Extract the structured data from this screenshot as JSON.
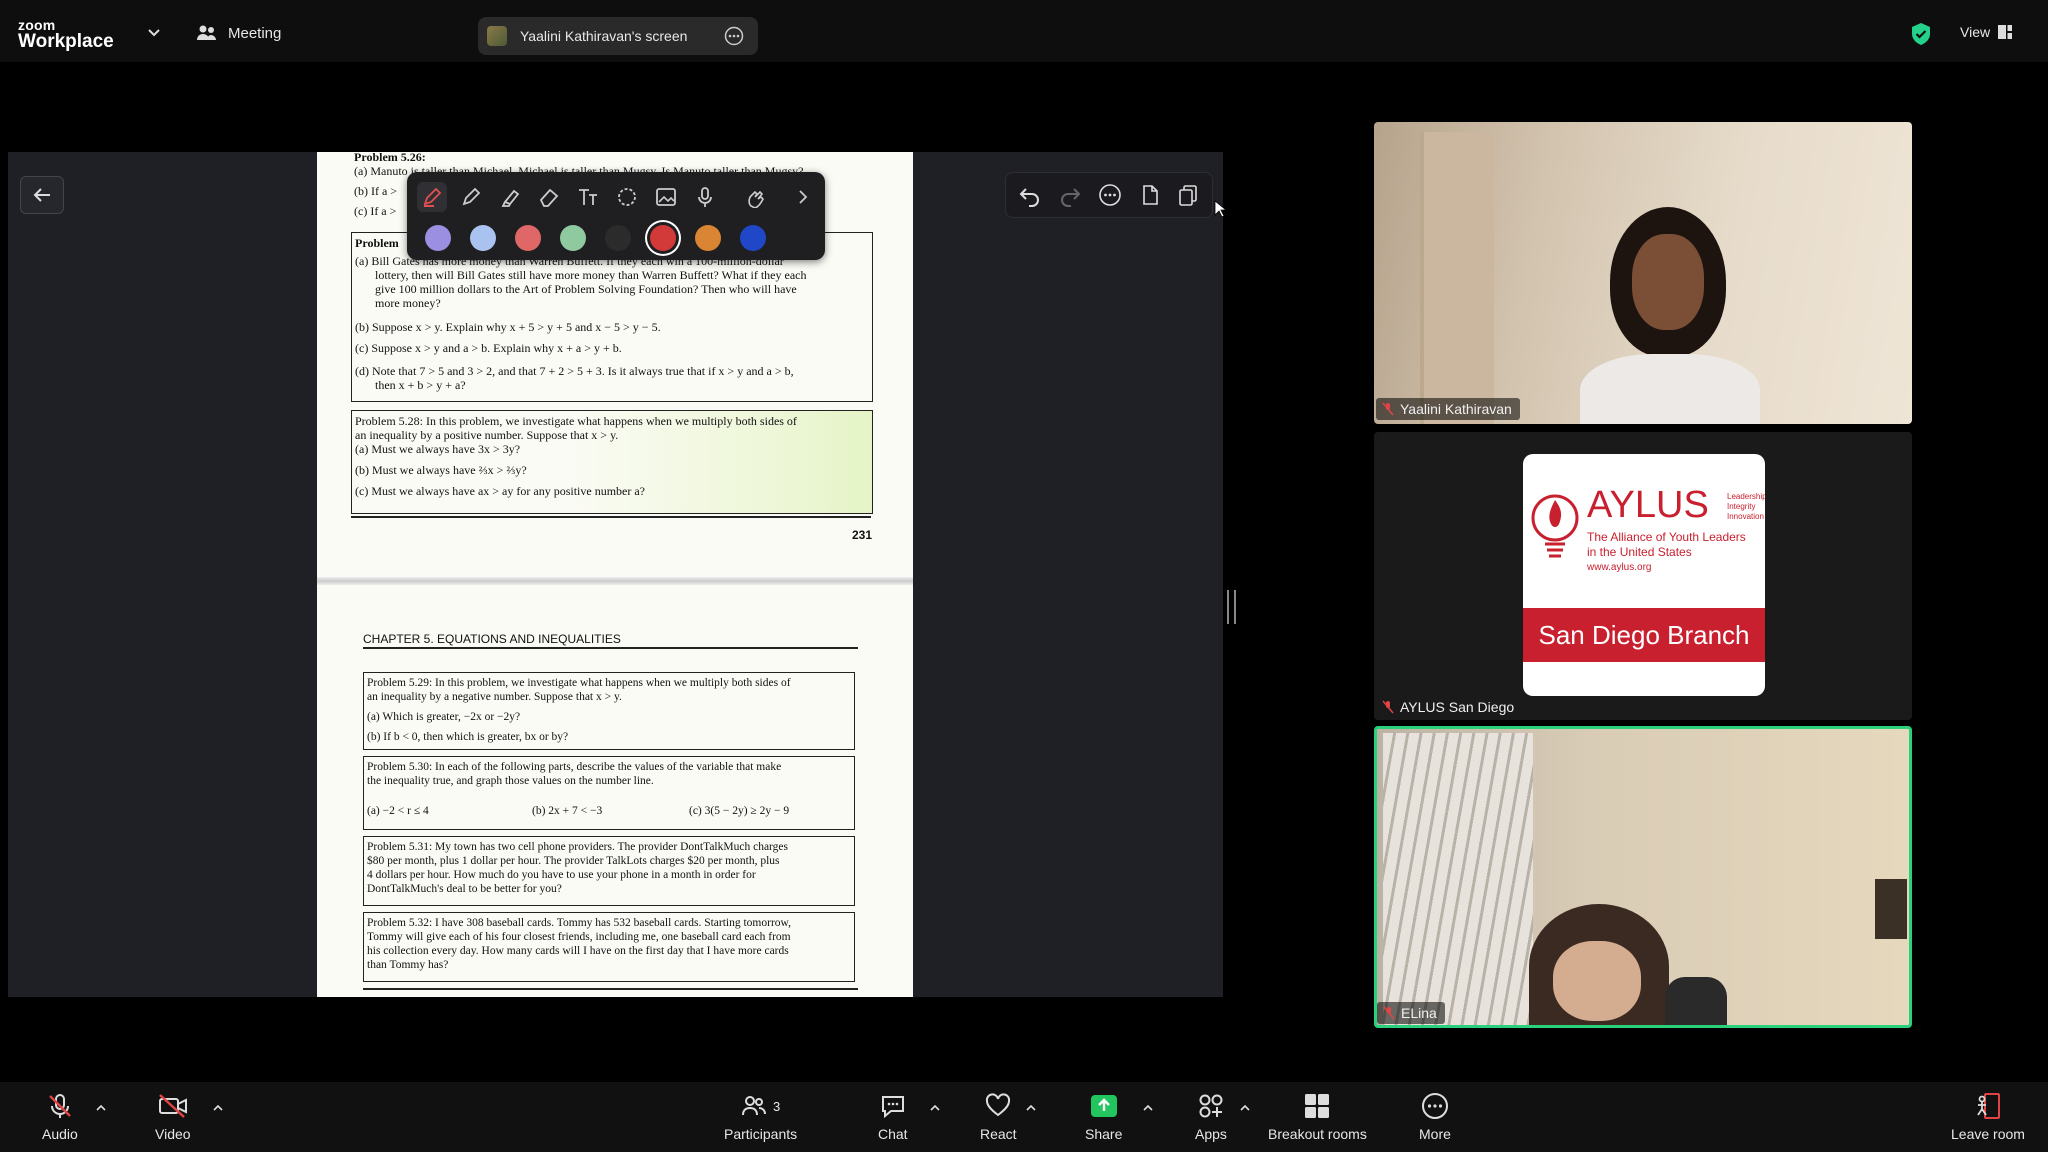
{
  "topbar": {
    "logo_small": "zoom",
    "logo_big": "Workplace",
    "meeting_label": "Meeting",
    "sharing_label": "Yaalini Kathiravan's screen",
    "view_label": "View"
  },
  "colors": {
    "accent_green": "#23d18b",
    "active_speaker_border": "#2ad07a",
    "brand_red": "#c8202f",
    "share_green": "#22c55e"
  },
  "document": {
    "top_problem_title": "Problem 5.26:",
    "top_lines": [
      "(a) Manuto is taller than Michael. Michael is taller than Mugsy. Is Manuto taller than Mugsy?",
      "(b) If a > ",
      "(c) If a > "
    ],
    "p527_label": "Problem",
    "p527_lines": [
      "(a) Bill Gates has more money than Warren Buffett. If they each win a 100-million-dollar",
      "lottery, then will Bill Gates still have more money than Warren Buffett? What if they each",
      "give 100 million dollars to the Art of Problem Solving Foundation? Then who will have",
      "more money?",
      "(b) Suppose x > y. Explain why x + 5 > y + 5 and x − 5 > y − 5.",
      "(c) Suppose x > y and a > b. Explain why x + a > y + b.",
      "(d) Note that 7 > 5 and 3 > 2, and that 7 + 2 > 5 + 3. Is it always true that if x > y and a > b,",
      "then x + b > y + a?"
    ],
    "p528_lines": [
      "Problem 5.28: In this problem, we investigate what happens when we multiply both sides of",
      "an inequality by a positive number. Suppose that x > y.",
      "(a) Must we always have 3x > 3y?",
      "(b) Must we always have ⅔x > ⅔y?",
      "(c) Must we always have ax > ay for any positive number a?"
    ],
    "page_number": "231",
    "chapter_header": "CHAPTER 5.  EQUATIONS AND INEQUALITIES",
    "p529_lines": [
      "Problem 5.29: In this problem, we investigate what happens when we multiply both sides of",
      "an inequality by a negative number. Suppose that x > y.",
      "(a) Which is greater, −2x or −2y?",
      "(b) If b < 0, then which is greater, bx or by?"
    ],
    "p530_lines": [
      "Problem 5.30: In each of the following parts, describe the values of the variable that make",
      "the inequality true, and graph those values on the number line."
    ],
    "p530_parts": [
      "(a)  −2 < r ≤ 4",
      "(b)  2x + 7 < −3",
      "(c)  3(5 − 2y) ≥ 2y − 9"
    ],
    "p531_lines": [
      "Problem 5.31: My town has two cell phone providers. The provider DontTalkMuch charges",
      "$80 per month, plus 1 dollar per hour. The provider TalkLots charges $20 per month, plus",
      "4 dollars per hour. How much do you have to use your phone in a month in order for",
      "DontTalkMuch's deal to be better for you?"
    ],
    "p532_lines": [
      "Problem 5.32: I have 308 baseball cards. Tommy has 532 baseball cards. Starting tomorrow,",
      "Tommy will give each of his four closest friends, including me, one baseball card each from",
      "his collection every day. How many cards will I have on the first day that I have more cards",
      "than Tommy has?"
    ]
  },
  "annotation": {
    "palette": [
      "#9a8fe0",
      "#a9c2f0",
      "#e06767",
      "#8fc9a0",
      "#2b2b2b",
      "#d23a3a",
      "#d98534",
      "#2047c7"
    ]
  },
  "participants": [
    {
      "name": "Yaalini Kathiravan"
    },
    {
      "name": "AYLUS San Diego"
    },
    {
      "name": "ELina"
    }
  ],
  "aylus_card": {
    "brand": "AYLUS",
    "tagline": [
      "Leadership",
      "Integrity",
      "Innovation"
    ],
    "subtitle": [
      "The Alliance of Youth Leaders",
      "in the United States"
    ],
    "url": "www.aylus.org",
    "branch": "San Diego Branch"
  },
  "bottombar": {
    "audio": "Audio",
    "video": "Video",
    "participants": "Participants",
    "participants_count": "3",
    "chat": "Chat",
    "react": "React",
    "share": "Share",
    "apps": "Apps",
    "breakout": "Breakout rooms",
    "more": "More",
    "leave": "Leave room"
  }
}
